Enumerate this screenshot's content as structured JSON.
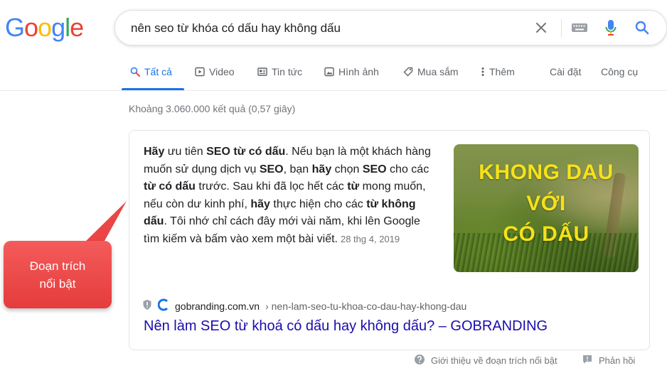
{
  "logo": {
    "letters": [
      {
        "ch": "G",
        "color": "#4285F4"
      },
      {
        "ch": "o",
        "color": "#EA4335"
      },
      {
        "ch": "o",
        "color": "#FBBC05"
      },
      {
        "ch": "g",
        "color": "#4285F4"
      },
      {
        "ch": "l",
        "color": "#34A853"
      },
      {
        "ch": "e",
        "color": "#EA4335"
      }
    ]
  },
  "search": {
    "query": "nên seo từ khóa có dấu hay không dấu",
    "icons": [
      "close-icon",
      "keyboard-icon",
      "microphone-icon",
      "search-icon"
    ]
  },
  "tabs": [
    {
      "label": "Tất cả",
      "icon": "search-icon",
      "active": true
    },
    {
      "label": "Video",
      "icon": "play-icon"
    },
    {
      "label": "Tin tức",
      "icon": "news-icon"
    },
    {
      "label": "Hình ảnh",
      "icon": "image-icon"
    },
    {
      "label": "Mua sắm",
      "icon": "tag-icon"
    },
    {
      "label": "Thêm",
      "icon": "more-vert-icon"
    },
    {
      "label": "Cài đặt"
    },
    {
      "label": "Công cụ"
    }
  ],
  "result_count": "Khoảng 3.060.000 kết quả (0,57 giây)",
  "snippet": {
    "parts": [
      {
        "t": "Hãy",
        "b": true
      },
      {
        "t": " ưu tiên "
      },
      {
        "t": "SEO từ có dấu",
        "b": true
      },
      {
        "t": ". Nếu bạn là một khách hàng muốn sử dụng dịch vụ "
      },
      {
        "t": "SEO",
        "b": true
      },
      {
        "t": ", bạn "
      },
      {
        "t": "hãy",
        "b": true
      },
      {
        "t": " chọn "
      },
      {
        "t": "SEO",
        "b": true
      },
      {
        "t": " cho các "
      },
      {
        "t": "từ có dấu",
        "b": true
      },
      {
        "t": " trước. Sau khi đã lọc hết các "
      },
      {
        "t": "từ",
        "b": true
      },
      {
        "t": " mong muốn, nếu còn dư kinh phí, "
      },
      {
        "t": "hãy",
        "b": true
      },
      {
        "t": " thực hiện cho các "
      },
      {
        "t": "từ không dấu",
        "b": true
      },
      {
        "t": ". Tôi nhớ chỉ cách đây mới vài năm, khi lên Google tìm kiếm và bấm vào xem một bài viết."
      }
    ],
    "date": "28 thg 4, 2019"
  },
  "thumbnail": {
    "lines": [
      "KHONG DAU",
      "VỚI",
      "CÓ DẤU"
    ],
    "text_color": "#F6E21A"
  },
  "source": {
    "domain": "gobranding.com.vn",
    "path": "› nen-lam-seo-tu-khoa-co-dau-hay-khong-dau"
  },
  "result_title": "Nên làm SEO từ khoá có dấu hay không dấu? – GOBRANDING",
  "footer": {
    "about": "Giới thiệu về đoạn trích nổi bật",
    "feedback": "Phản hồi"
  },
  "callout": {
    "lines": [
      "Đoạn trích",
      "nổi bật"
    ],
    "color": "#E53C3C"
  },
  "colors": {
    "accent": "#1a73e8",
    "link": "#1a0dab"
  }
}
